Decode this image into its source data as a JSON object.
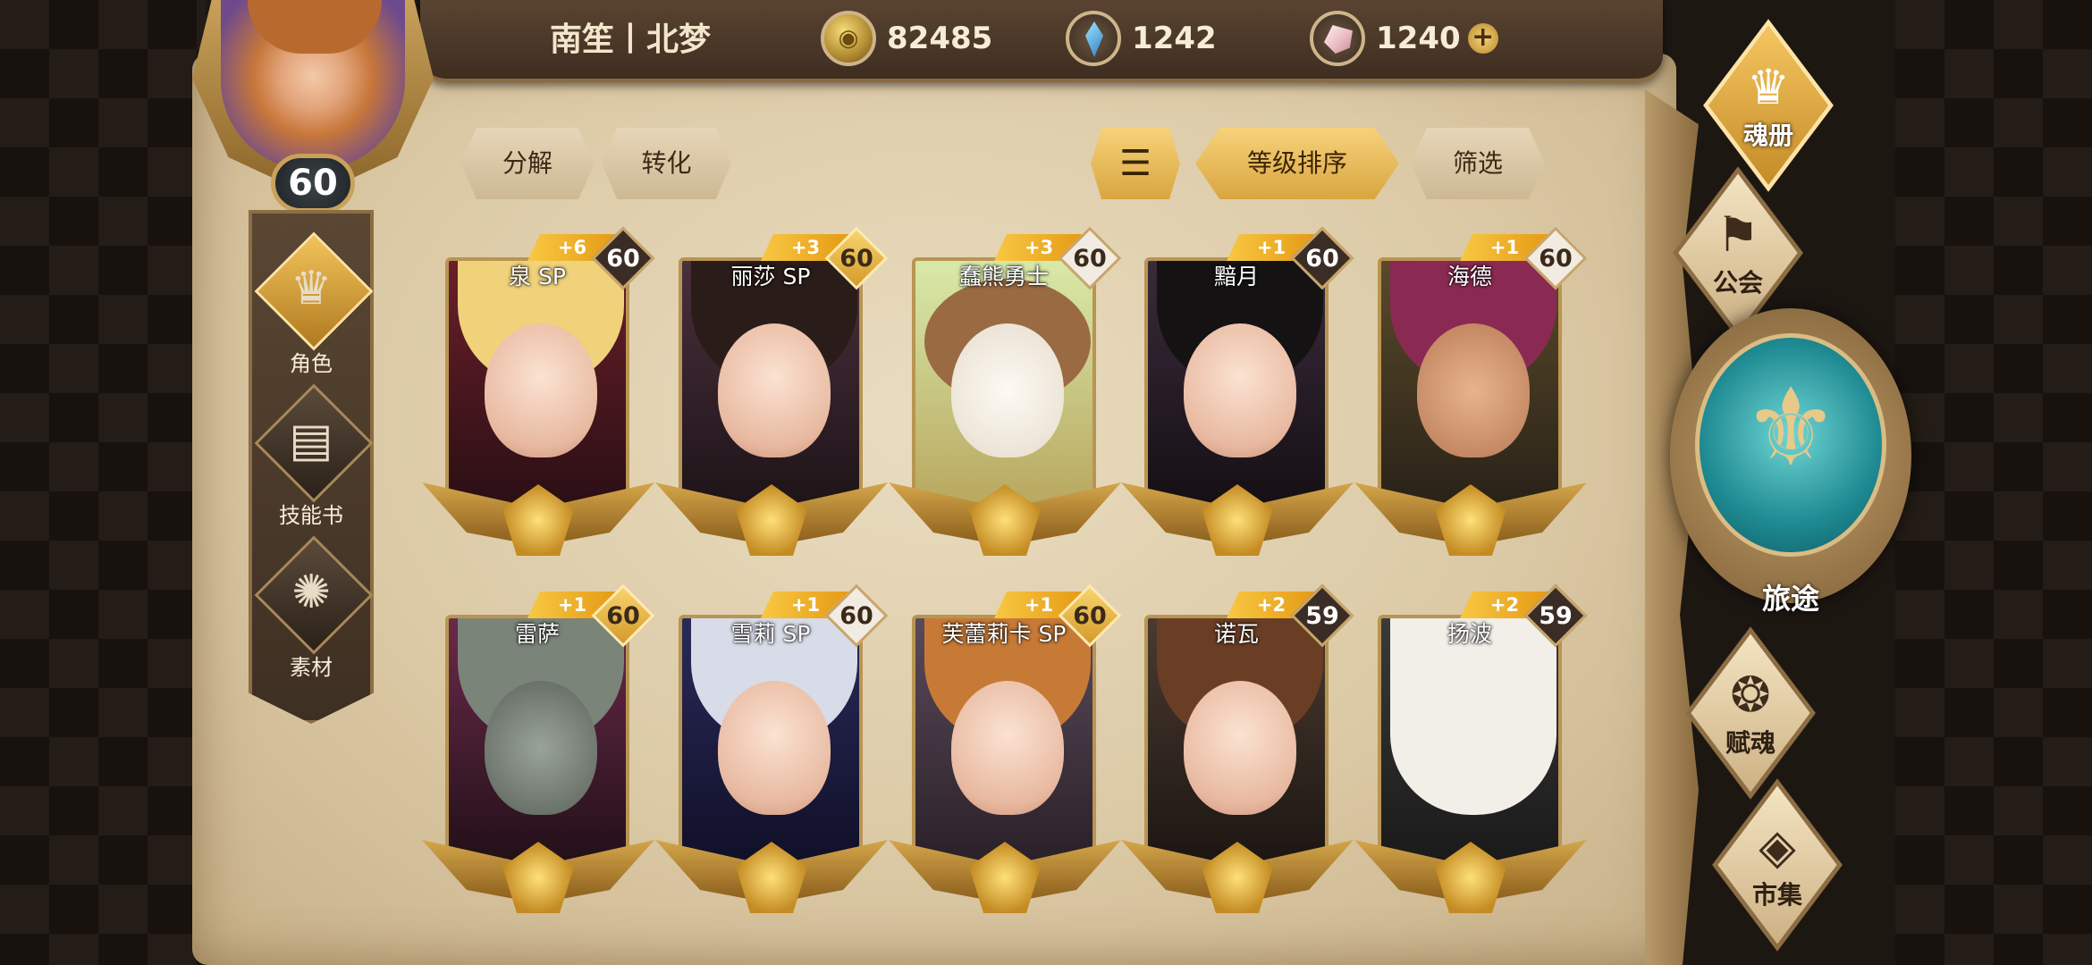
{
  "header": {
    "player_name": "南笙丨北梦",
    "player_level": "60",
    "currencies": [
      {
        "icon": "gold-coin-icon",
        "value": "82485"
      },
      {
        "icon": "blue-gem-icon",
        "value": "1242"
      },
      {
        "icon": "pink-crystal-icon",
        "value": "1240"
      }
    ]
  },
  "left_nav": {
    "items": [
      {
        "label": "角色",
        "icon": "helmet-icon",
        "active": true
      },
      {
        "label": "技能书",
        "icon": "book-icon",
        "active": false
      },
      {
        "label": "素材",
        "icon": "creature-icon",
        "active": false
      }
    ]
  },
  "toolbar": {
    "decompose": "分解",
    "convert": "转化",
    "sort_icon": "sort-icon",
    "sort_by_level": "等级排序",
    "filter": "筛选"
  },
  "cards": [
    {
      "name": "泉 SP",
      "plus": "+6",
      "level": "60",
      "badge": "dark"
    },
    {
      "name": "丽莎 SP",
      "plus": "+3",
      "level": "60",
      "badge": "gold"
    },
    {
      "name": "蠢熊勇士",
      "plus": "+3",
      "level": "60",
      "badge": "light"
    },
    {
      "name": "黯月",
      "plus": "+1",
      "level": "60",
      "badge": "dark"
    },
    {
      "name": "海德",
      "plus": "+1",
      "level": "60",
      "badge": "light"
    },
    {
      "name": "雷萨",
      "plus": "+1",
      "level": "60",
      "badge": "gold"
    },
    {
      "name": "雪莉 SP",
      "plus": "+1",
      "level": "60",
      "badge": "light"
    },
    {
      "name": "芙蕾莉卡 SP",
      "plus": "+1",
      "level": "60",
      "badge": "gold"
    },
    {
      "name": "诺瓦",
      "plus": "+2",
      "level": "59",
      "badge": "dark"
    },
    {
      "name": "扬波",
      "plus": "+2",
      "level": "59",
      "badge": "dark"
    }
  ],
  "right_menu": {
    "soul_book": "魂册",
    "guild": "公会",
    "journey": "旅途",
    "endow_soul": "赋魂",
    "market": "市集"
  },
  "colors": {
    "accent_gold": "#f2c35a",
    "parchment": "#e3d3b2",
    "teal_orb": "#2aa3a8"
  }
}
